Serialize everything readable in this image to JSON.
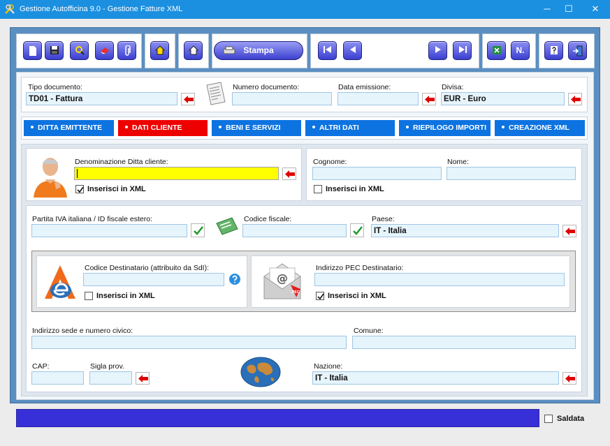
{
  "window": {
    "title": "Gestione Autofficina 9.0 - Gestione Fatture XML",
    "minimize": "─",
    "maximize": "☐",
    "close": "✕"
  },
  "toolbar": {
    "stampa_label": "Stampa",
    "numbering_label": "N."
  },
  "header": {
    "tipo_documento_label": "Tipo documento:",
    "tipo_documento_value": "TD01 - Fattura",
    "numero_documento_label": "Numero documento:",
    "numero_documento_value": "",
    "data_emissione_label": "Data emissione:",
    "data_emissione_value": "",
    "divisa_label": "Divisa:",
    "divisa_value": "EUR - Euro"
  },
  "tabs": [
    {
      "label": "DITTA EMITTENTE",
      "active": false
    },
    {
      "label": "DATI CLIENTE",
      "active": true
    },
    {
      "label": "BENI E SERVIZI",
      "active": false
    },
    {
      "label": "ALTRI DATI",
      "active": false
    },
    {
      "label": "RIEPILOGO IMPORTI",
      "active": false
    },
    {
      "label": "CREAZIONE XML",
      "active": false
    }
  ],
  "cliente": {
    "denominazione_label": "Denominazione Ditta cliente:",
    "denominazione_value": "",
    "inserisci_denominazione": "Inserisci in XML",
    "inserisci_denominazione_checked": true,
    "cognome_label": "Cognome:",
    "cognome_value": "",
    "nome_label": "Nome:",
    "nome_value": "",
    "inserisci_nome": "Inserisci in XML",
    "inserisci_nome_checked": false,
    "piva_label": "Partita IVA italiana / ID fiscale estero:",
    "piva_value": "",
    "codice_fiscale_label": "Codice fiscale:",
    "codice_fiscale_value": "",
    "paese_label": "Paese:",
    "paese_value": "IT - Italia",
    "codice_destinatario_label": "Codice Destinatario (attribuito da SdI):",
    "codice_destinatario_value": "",
    "inserisci_codice_dest": "Inserisci in XML",
    "inserisci_codice_dest_checked": false,
    "pec_label": "Indirizzo PEC Destinatario:",
    "pec_value": "",
    "inserisci_pec": "Inserisci in XML",
    "inserisci_pec_checked": true,
    "indirizzo_label": "Indirizzo sede e numero civico:",
    "indirizzo_value": "",
    "comune_label": "Comune:",
    "comune_value": "",
    "cap_label": "CAP:",
    "cap_value": "",
    "sigla_label": "Sigla prov.",
    "sigla_value": "",
    "nazione_label": "Nazione:",
    "nazione_value": "IT - Italia",
    "pec_badge": "PEC"
  },
  "footer": {
    "saldata_label": "Saldata",
    "saldata_checked": false
  },
  "colors": {
    "titlebar": "#1b8fe0",
    "tab_active": "#ee0000",
    "tab_inactive": "#0d73e0",
    "statusbar": "#3730d8",
    "field_bg": "#e6f4fc",
    "highlight_field": "#ffff00"
  }
}
